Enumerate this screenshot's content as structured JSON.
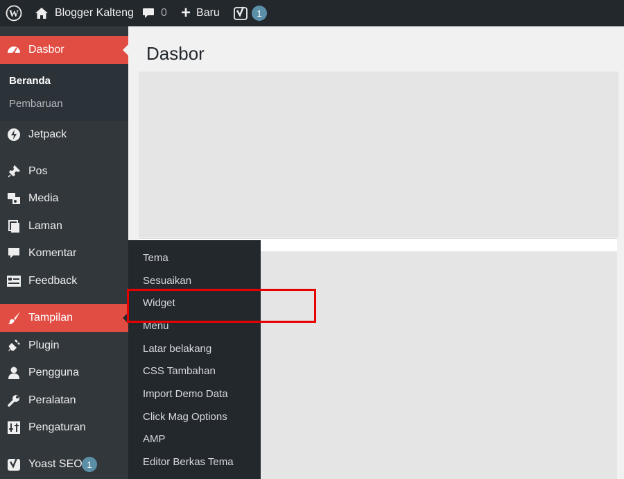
{
  "adminbar": {
    "site_name": "Blogger Kalteng",
    "comments_count": "0",
    "new_label": "Baru",
    "yoast_badge": "1"
  },
  "sidebar": {
    "items": [
      {
        "label": "Dasbor",
        "icon": "dashboard-icon"
      },
      {
        "label": "Jetpack",
        "icon": "jetpack-icon"
      },
      {
        "label": "Pos",
        "icon": "pushpin-icon"
      },
      {
        "label": "Media",
        "icon": "media-icon"
      },
      {
        "label": "Laman",
        "icon": "pages-icon"
      },
      {
        "label": "Komentar",
        "icon": "comment-icon"
      },
      {
        "label": "Feedback",
        "icon": "feedback-icon"
      },
      {
        "label": "Tampilan",
        "icon": "paintbrush-icon"
      },
      {
        "label": "Plugin",
        "icon": "plugin-icon"
      },
      {
        "label": "Pengguna",
        "icon": "user-icon"
      },
      {
        "label": "Peralatan",
        "icon": "wrench-icon"
      },
      {
        "label": "Pengaturan",
        "icon": "settings-icon"
      },
      {
        "label": "Yoast SEO",
        "icon": "yoast-icon",
        "badge": "1"
      }
    ],
    "dashboard_sub": [
      "Beranda",
      "Pembaruan"
    ]
  },
  "main": {
    "title": "Dasbor"
  },
  "flyout": {
    "items": [
      "Tema",
      "Sesuaikan",
      "Widget",
      "Menu",
      "Latar belakang",
      "CSS Tambahan",
      "Import Demo Data",
      "Click Mag Options",
      "AMP",
      "Editor Berkas Tema"
    ]
  },
  "colors": {
    "adminbar": "#23282d",
    "sidebar": "#32373c",
    "active": "#e14d43",
    "highlight": "#e60000"
  }
}
